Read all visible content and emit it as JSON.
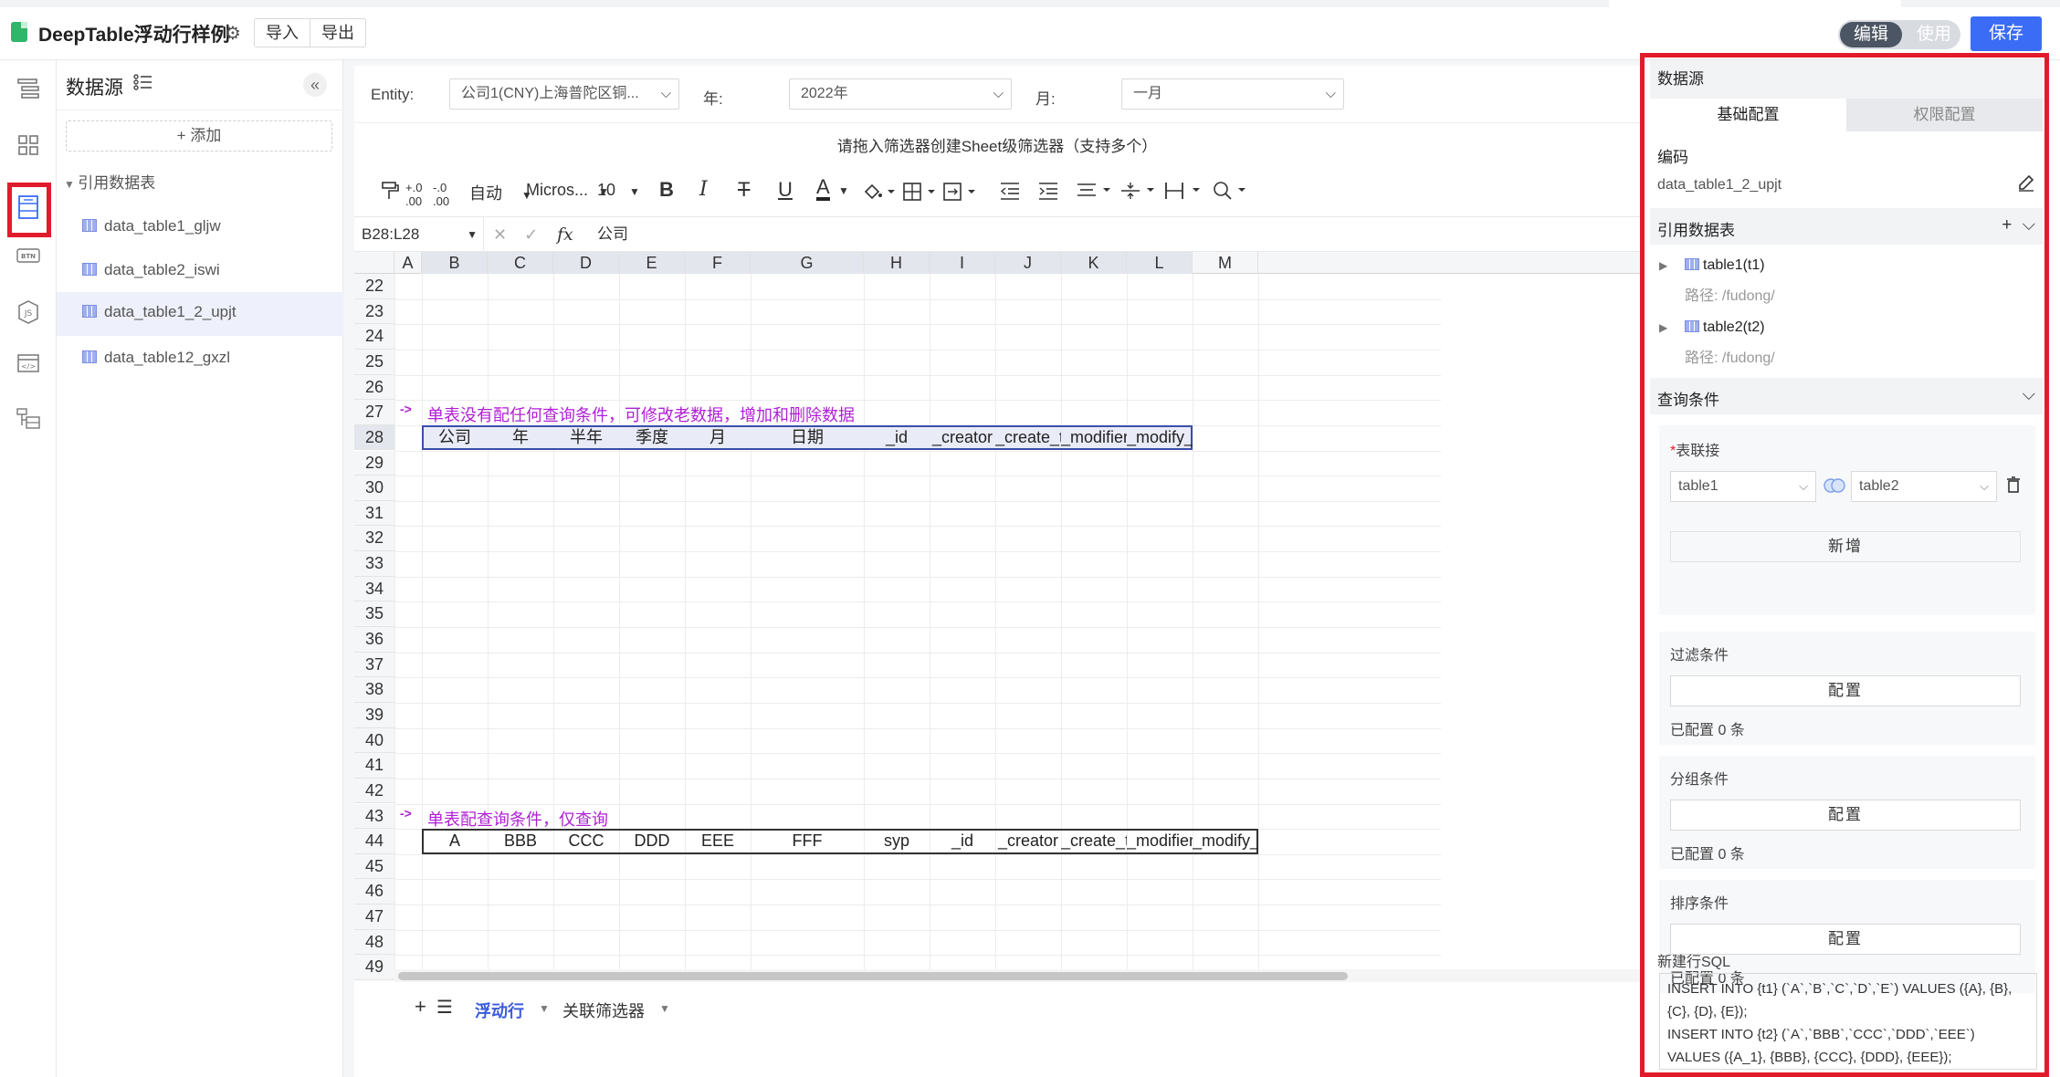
{
  "app": {
    "title": "DeepTable浮动行样例",
    "import_label": "导入",
    "export_label": "导出",
    "mode_edit": "编辑",
    "mode_use": "使用",
    "save_label": "保存"
  },
  "datasource": {
    "title": "数据源",
    "add_label": "+ 添加",
    "ref_section": "引用数据表",
    "items": [
      {
        "label": "data_table1_gljw"
      },
      {
        "label": "data_table2_iswi"
      },
      {
        "label": "data_table1_2_upjt"
      },
      {
        "label": "data_table12_gxzl"
      }
    ],
    "active_index": 2
  },
  "filters": {
    "entity_label": "Entity:",
    "entity_value": "公司1(CNY)上海普陀区铜...",
    "year_label": "年:",
    "year_value": "2022年",
    "month_label": "月:",
    "month_value": "一月",
    "hint": "请拖入筛选器创建Sheet级筛选器（支持多个）"
  },
  "toolbar": {
    "wrap": "自动",
    "font": "Micros...",
    "size": "10",
    "bold": "B",
    "italic": "I",
    "strike": "T",
    "underline": "U",
    "font_color": "A"
  },
  "formula": {
    "namebox": "B28:L28",
    "fx": "fx",
    "value": "公司"
  },
  "grid": {
    "columns": [
      "A",
      "B",
      "C",
      "D",
      "E",
      "F",
      "G",
      "H",
      "I",
      "J",
      "K",
      "L",
      "M"
    ],
    "rows": [
      "22",
      "23",
      "24",
      "25",
      "26",
      "27",
      "28",
      "29",
      "30",
      "31",
      "32",
      "33",
      "34",
      "35",
      "36",
      "37",
      "38",
      "39",
      "40",
      "41",
      "42",
      "43",
      "44",
      "45",
      "46",
      "47",
      "48",
      "49"
    ],
    "note1": "单表没有配任何查询条件，可修改老数据，增加和删除数据",
    "note2": "单表配查询条件，仅查询",
    "arrow": "->",
    "row28": [
      "公司",
      "年",
      "半年",
      "季度",
      "月",
      "日期",
      "_id",
      "_creator",
      "_create_t...",
      "_modifier",
      "_modify_..."
    ],
    "row44": [
      "A",
      "BBB",
      "CCC",
      "DDD",
      "EEE",
      "FFF",
      "syp",
      "_id",
      "_creator",
      "_create_t...",
      "_modifier",
      "_modify_..."
    ]
  },
  "sheet_tabs": {
    "tab1": "浮动行",
    "tab2": "关联筛选器"
  },
  "right_panel": {
    "title": "数据源",
    "tab_basic": "基础配置",
    "tab_perm": "权限配置",
    "code_label": "编码",
    "code_value": "data_table1_2_upjt",
    "ref_tables": "引用数据表",
    "tables": [
      {
        "name": "table1(t1)",
        "path": "路径: /fudong/"
      },
      {
        "name": "table2(t2)",
        "path": "路径: /fudong/"
      }
    ],
    "query_conditions": "查询条件",
    "join_label": "表联接",
    "join_left": "table1",
    "join_right": "table2",
    "add_new": "新增",
    "filter_label": "过滤条件",
    "group_label": "分组条件",
    "sort_label": "排序条件",
    "config_btn": "配置",
    "configured": "已配置 0 条",
    "sql_label": "新建行SQL",
    "sql_lines": [
      "INSERT INTO {t1} (`A`,`B`,`C`,`D`,`E`) VALUES ({A}, {B},",
      "{C}, {D}, {E});",
      "INSERT INTO {t2} (`A`,`BBB`,`CCC`,`DDD`,`EEE`)",
      "VALUES ({A_1}, {BBB}, {CCC}, {DDD}, {EEE});"
    ]
  },
  "colors": {
    "accent": "#3b6cf6",
    "highlight_red": "#e21b2c",
    "note_purple": "#b01fd6"
  }
}
